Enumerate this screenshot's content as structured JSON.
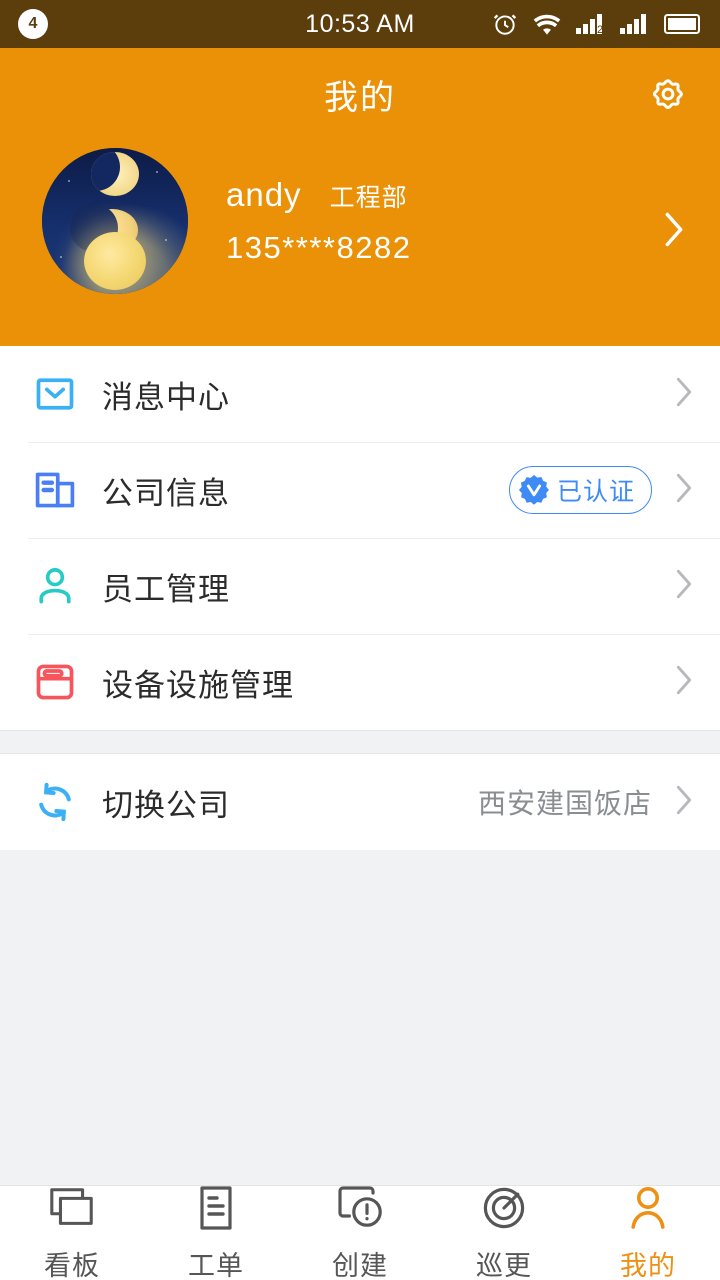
{
  "status_bar": {
    "notification_count": "4",
    "time": "10:53 AM",
    "icons": [
      "alarm-icon",
      "wifi-icon",
      "signal-sim1-icon",
      "signal-sim2-icon",
      "battery-icon"
    ]
  },
  "header": {
    "title": "我的",
    "settings_icon": "gear-icon"
  },
  "profile": {
    "avatar_icon": "moon-phases-avatar",
    "name": "andy",
    "department": "工程部",
    "phone": "135****8282",
    "chevron_icon": "chevron-right-icon"
  },
  "menu": {
    "group_one": [
      {
        "icon": "envelope-icon",
        "label": "消息中心",
        "value": "",
        "badge": ""
      },
      {
        "icon": "building-icon",
        "label": "公司信息",
        "value": "",
        "badge": "已认证"
      },
      {
        "icon": "person-icon",
        "label": "员工管理",
        "value": "",
        "badge": ""
      },
      {
        "icon": "device-icon",
        "label": "设备设施管理",
        "value": "",
        "badge": ""
      }
    ],
    "group_two": [
      {
        "icon": "refresh-icon",
        "label": "切换公司",
        "value": "西安建国饭店",
        "badge": ""
      }
    ]
  },
  "tabs": [
    {
      "icon": "board-icon",
      "label": "看板",
      "active": false
    },
    {
      "icon": "order-icon",
      "label": "工单",
      "active": false
    },
    {
      "icon": "create-icon",
      "label": "创建",
      "active": false
    },
    {
      "icon": "patrol-icon",
      "label": "巡更",
      "active": false
    },
    {
      "icon": "user-icon",
      "label": "我的",
      "active": true
    }
  ],
  "colors": {
    "status_bar_bg": "#5c3d0c",
    "header_bg": "#ea9108",
    "accent_orange": "#ee9013",
    "verified_blue": "#3e8bf5",
    "envelope_blue": "#3bb0f5",
    "building_blue": "#4a7ef5",
    "person_teal": "#27cbc6",
    "device_red": "#f8545c",
    "refresh_blue": "#3bb0f5",
    "page_bg": "#f1f2f4",
    "card_bg": "#ffffff"
  }
}
